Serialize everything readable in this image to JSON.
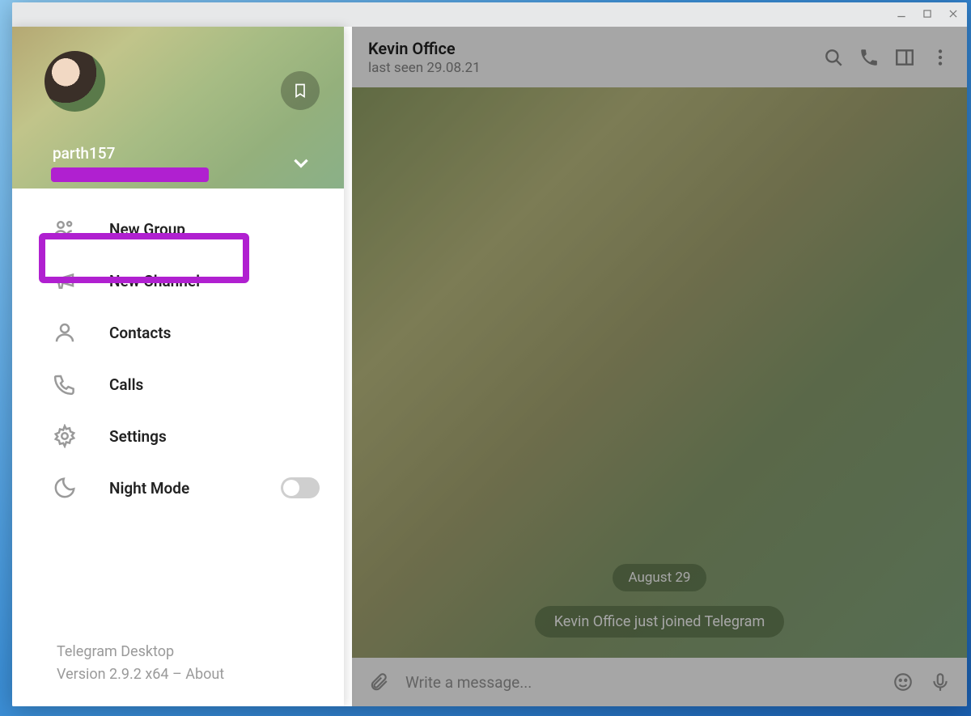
{
  "profile": {
    "username": "parth157"
  },
  "menu": {
    "items": [
      {
        "label": "New Group"
      },
      {
        "label": "New Channel"
      },
      {
        "label": "Contacts"
      },
      {
        "label": "Calls"
      },
      {
        "label": "Settings"
      },
      {
        "label": "Night Mode"
      }
    ],
    "highlighted_index": 4
  },
  "footer": {
    "app_name": "Telegram Desktop",
    "version_line": "Version 2.9.2 x64 – About"
  },
  "chat": {
    "header": {
      "title": "Kevin Office",
      "status": "last seen 29.08.21"
    },
    "date_label": "August 29",
    "system_message": "Kevin Office just joined Telegram",
    "input_placeholder": "Write a message..."
  }
}
